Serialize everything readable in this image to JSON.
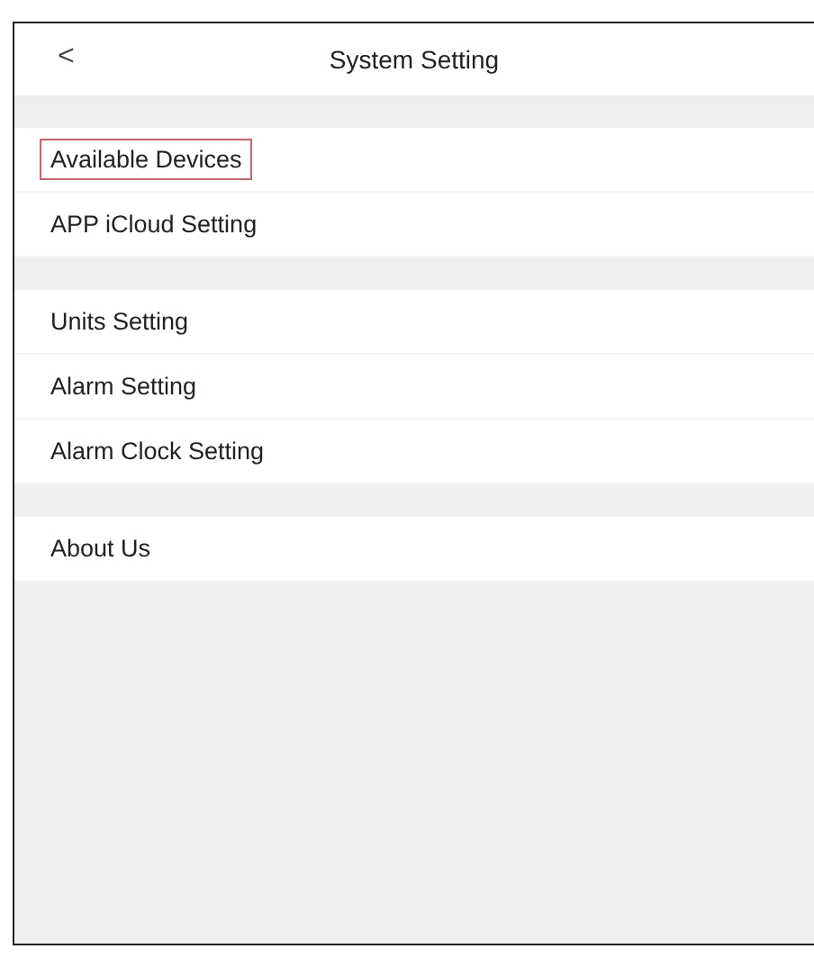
{
  "header": {
    "back": "<",
    "title": "System Setting"
  },
  "sections": [
    {
      "items": [
        {
          "label": "Available Devices",
          "highlighted": true
        },
        {
          "label": "APP iCloud Setting",
          "highlighted": false
        }
      ]
    },
    {
      "items": [
        {
          "label": "Units Setting",
          "highlighted": false
        },
        {
          "label": "Alarm Setting",
          "highlighted": false
        },
        {
          "label": "Alarm Clock Setting",
          "highlighted": false
        }
      ]
    },
    {
      "items": [
        {
          "label": "About Us",
          "highlighted": false
        }
      ]
    }
  ]
}
